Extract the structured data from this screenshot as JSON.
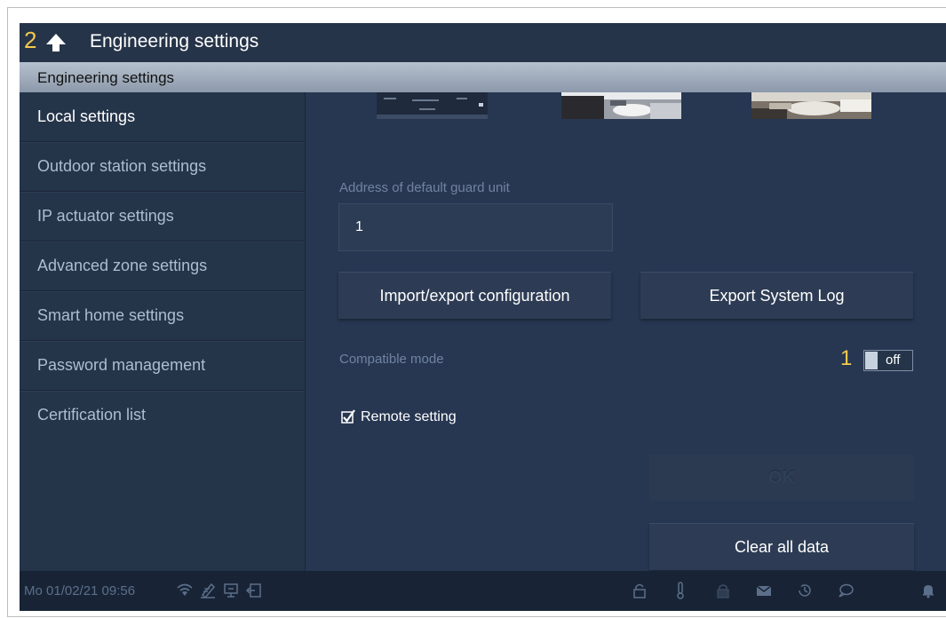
{
  "header": {
    "badge": "2",
    "title": "Engineering settings",
    "back_icon": "arrow-up-icon"
  },
  "section": {
    "label": "Engineering settings"
  },
  "sidebar": {
    "items": [
      {
        "label": "Local settings",
        "active": true
      },
      {
        "label": "Outdoor station settings"
      },
      {
        "label": "IP actuator settings"
      },
      {
        "label": "Advanced zone settings"
      },
      {
        "label": "Smart home settings"
      },
      {
        "label": "Password management"
      },
      {
        "label": "Certification list"
      }
    ]
  },
  "main": {
    "guard_unit": {
      "label": "Address of default guard unit",
      "value": "1"
    },
    "buttons": {
      "import_export": "Import/export configuration",
      "export_log": "Export System Log"
    },
    "compatible_mode": {
      "label": "Compatible mode",
      "badge": "1",
      "toggle_state": "off"
    },
    "remote_setting": {
      "label": "Remote setting",
      "checked": true
    },
    "ok": "OK",
    "clear_all": "Clear all data"
  },
  "status_bar": {
    "datetime": "Mo 01/02/21  09:56",
    "left_icons": [
      "wifi-icon",
      "edit-icon",
      "monitor-icon",
      "exit-icon"
    ],
    "right_icons": [
      "lock-icon",
      "thermometer-icon",
      "lock-locked-icon",
      "mail-icon",
      "history-icon",
      "chat-icon",
      "bell-icon"
    ]
  },
  "colors": {
    "accent": "#f2c94c",
    "background": "#243349",
    "label": "#6f83a0"
  }
}
